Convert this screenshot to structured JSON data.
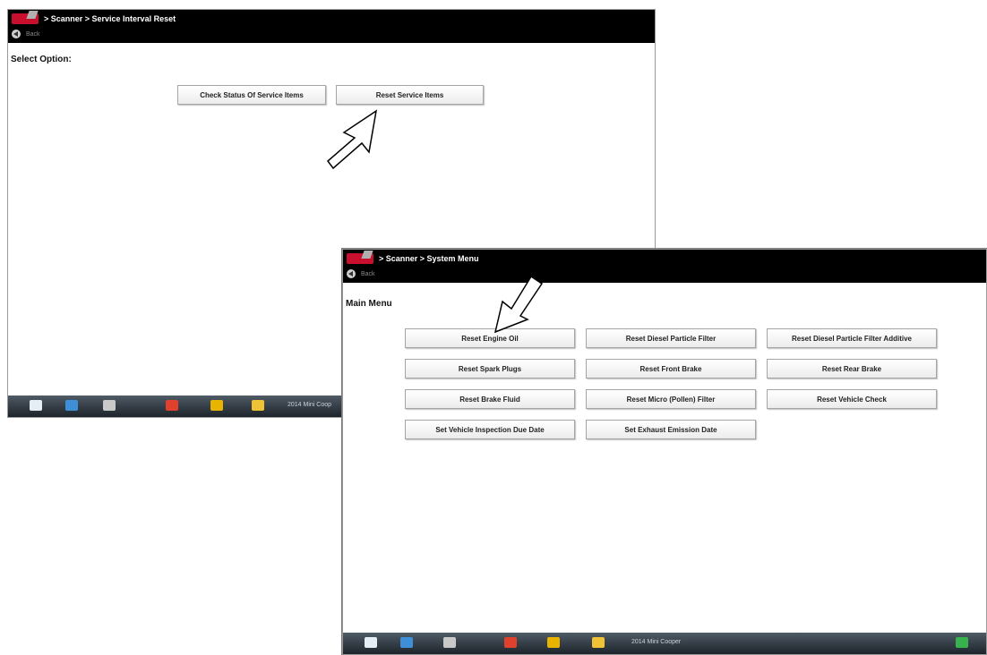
{
  "screen1": {
    "breadcrumb": "> Scanner  > Service Interval Reset",
    "back_label": "Back",
    "heading": "Select Option:",
    "buttons": {
      "check_status": "Check Status Of Service Items",
      "reset_items": "Reset Service Items"
    },
    "taskbar_text": "2014 Mini Coop"
  },
  "screen2": {
    "breadcrumb": "> Scanner  > System Menu",
    "back_label": "Back",
    "heading": "Main Menu",
    "buttons": {
      "reset_engine_oil": "Reset Engine Oil",
      "reset_dpf": "Reset Diesel Particle Filter",
      "reset_dpf_additive": "Reset Diesel Particle Filter Additive",
      "reset_spark_plugs": "Reset Spark Plugs",
      "reset_front_brake": "Reset Front Brake",
      "reset_rear_brake": "Reset Rear Brake",
      "reset_brake_fluid": "Reset Brake Fluid",
      "reset_micro_filter": "Reset Micro (Pollen) Filter",
      "reset_vehicle_check": "Reset Vehicle Check",
      "set_inspection_date": "Set Vehicle Inspection Due Date",
      "set_emission_date": "Set Exhaust Emission Date"
    },
    "taskbar_text": "2014 Mini Cooper"
  },
  "colors": {
    "topbar": "#000000",
    "logo": "#c8102e",
    "taskbar": "#2b333b"
  },
  "icons": [
    "home-icon",
    "vehicle-data-icon",
    "settings-sliders-icon",
    "save-icon",
    "shop-icon",
    "folder-icon",
    "back-icon"
  ]
}
